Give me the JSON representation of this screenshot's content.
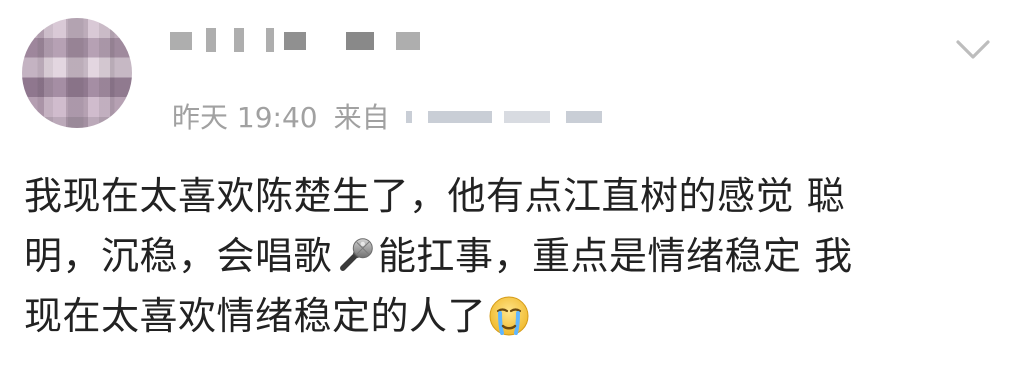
{
  "post": {
    "time": "昨天 19:40",
    "source_prefix": "来自",
    "text_lines": [
      "我现在太喜欢陈楚生了，他有点江直树的感觉 聪",
      "明，沉稳，会唱歌",
      "能扛事，重点是情绪稳定 我",
      "现在太喜欢情绪稳定的人了"
    ]
  },
  "icons": {
    "menu": "chevron-down-icon",
    "mic": "microphone-emoji",
    "cry": "crying-face-emoji"
  },
  "colors": {
    "meta_text": "#a1a1a1",
    "body_text": "#222222",
    "chevron": "#bdbdbd"
  }
}
